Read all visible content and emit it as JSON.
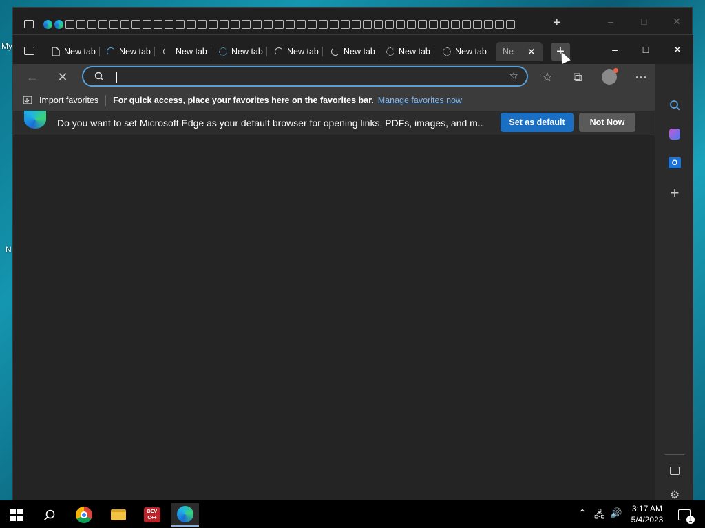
{
  "desktop": {
    "frag1": "My",
    "frag2": "N"
  },
  "tabs": [
    {
      "label": "New tab"
    },
    {
      "label": "New tab"
    },
    {
      "label": "New tab"
    },
    {
      "label": "New tab"
    },
    {
      "label": "New tab"
    },
    {
      "label": "New tab"
    },
    {
      "label": "New tab"
    },
    {
      "label": "New tab"
    },
    {
      "label": "Ne"
    }
  ],
  "address_bar": {
    "value": "",
    "placeholder": ""
  },
  "favorites_bar": {
    "import_label": "Import favorites",
    "message": "For quick access, place your favorites here on the favorites bar.",
    "manage_link": "Manage favorites now"
  },
  "banner": {
    "text": "Do you want to set Microsoft Edge as your default browser for opening links, PDFs, images, and m...",
    "primary_button": "Set as default",
    "secondary_button": "Not Now"
  },
  "taskbar": {
    "time": "3:17 AM",
    "date": "5/4/2023",
    "notification_count": "1",
    "devcpp_label": "DEV C++"
  },
  "colors": {
    "accent": "#1b6fc2",
    "address_border": "#5aa0d8",
    "link": "#7fb6ef"
  }
}
